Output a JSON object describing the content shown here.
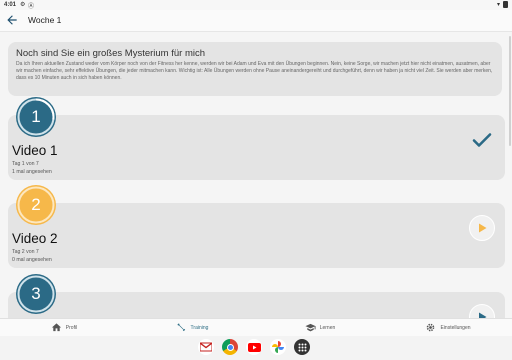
{
  "status_bar": {
    "time": "4:01",
    "icons": [
      "gear-icon",
      "circle-a-icon",
      "wifi-icon",
      "battery-icon"
    ]
  },
  "app_bar": {
    "title": "Woche 1",
    "back_icon": "arrow-left-icon"
  },
  "intro": {
    "heading": "Noch sind Sie ein großes Mysterium für mich",
    "text": "Da ich Ihren aktuellen Zustand weder vom Körper noch von der Fitness her kenne, werden wir bei Adam und Eva mit den Übungen beginnen. Nein, keine Sorge, wir machen jetzt hier nicht einatmen, ausatmen, aber wir machen einfache, sehr effektive Übungen, die jeder mitmachen kann. Wichtig ist: Alle Übungen werden ohne Pause aneinandergereiht und durchgeführt, denn wir haben ja nicht viel Zeit. Sie werden aber merken, dass es 10 Minuten auch in sich haben können."
  },
  "videos": [
    {
      "number": "1",
      "title": "Video 1",
      "day": "Tag 1 von 7",
      "views": "1 mal angesehen",
      "status": "done",
      "color": "#2b6a86",
      "action_icon": "check-icon",
      "progress": 1.0
    },
    {
      "number": "2",
      "title": "Video 2",
      "day": "Tag 2 von 7",
      "views": "0 mal angesehen",
      "status": "current",
      "color": "#f6b84a",
      "action_icon": "play-icon",
      "progress": 0.0
    },
    {
      "number": "3",
      "title": "",
      "day": "",
      "views": "",
      "status": "locked",
      "color": "#2b6a86",
      "action_icon": "play-icon",
      "progress": 0.0
    }
  ],
  "bottom_nav": [
    {
      "label": "Profil",
      "icon": "home-icon",
      "active": false
    },
    {
      "label": "Training",
      "icon": "dumbbell-icon",
      "active": true
    },
    {
      "label": "Lernen",
      "icon": "graduation-cap-icon",
      "active": false
    },
    {
      "label": "Einstellungen",
      "icon": "gear-icon",
      "active": false
    }
  ],
  "dock_apps": [
    "gmail-icon",
    "chrome-icon",
    "youtube-icon",
    "photos-icon",
    "app-drawer-icon"
  ],
  "colors": {
    "primary": "#2b6a86",
    "accent": "#f6b84a",
    "card_bg": "#e4e4e4"
  }
}
